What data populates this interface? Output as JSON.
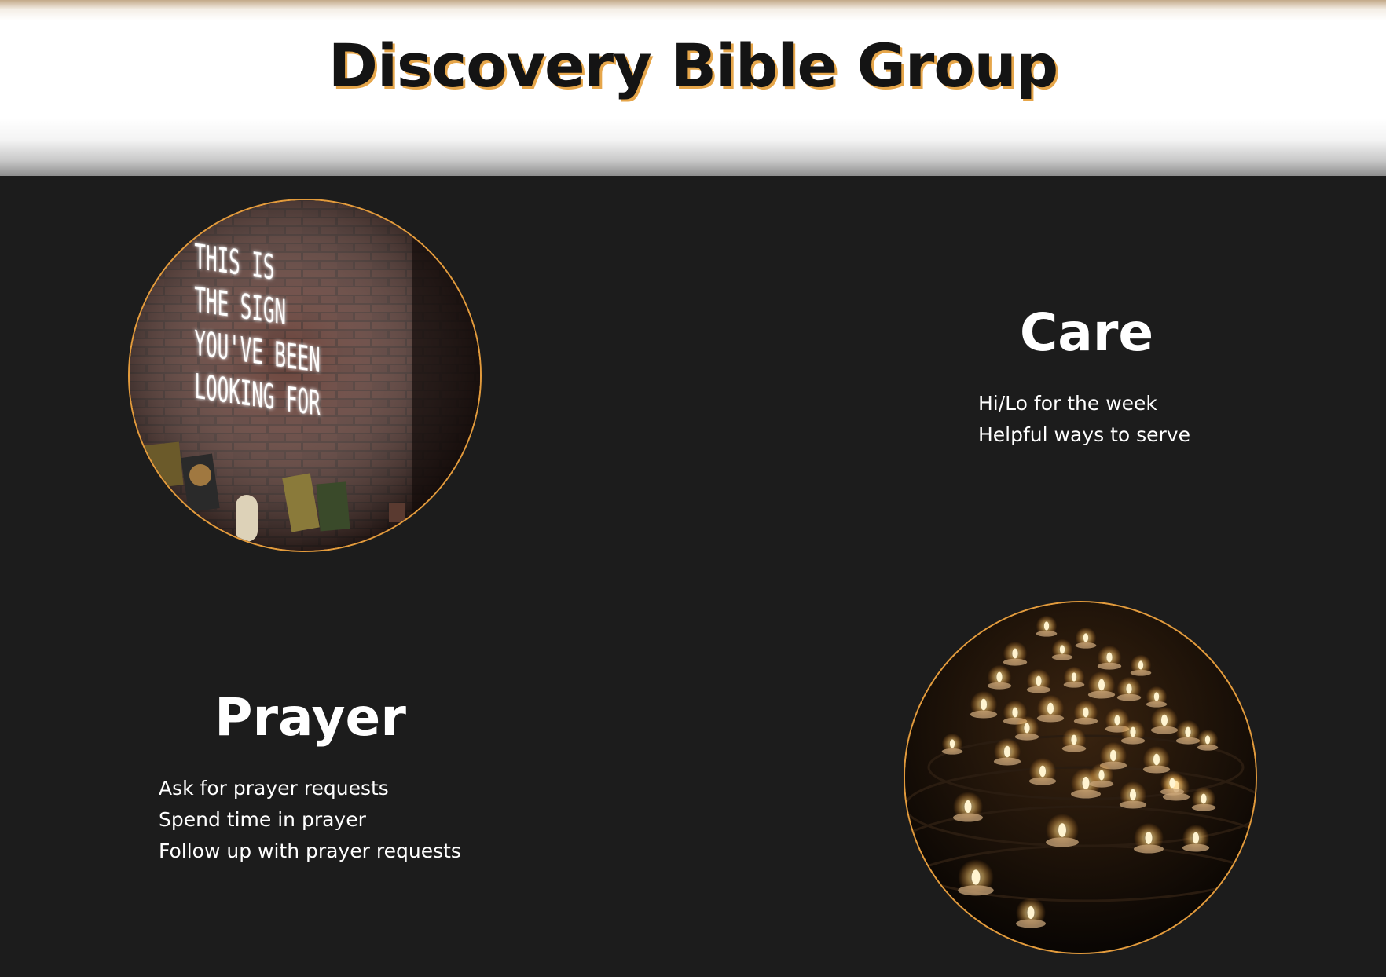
{
  "header": {
    "title": "Discovery Bible Group"
  },
  "images": {
    "neon_sign": {
      "lines": [
        "THIS IS",
        "THE SIGN",
        "YOU'VE BEEN",
        "LOOKING FOR"
      ]
    },
    "candles": {}
  },
  "care": {
    "heading": "Care",
    "items": [
      "Hi/Lo for the week",
      "Helpful ways to serve"
    ]
  },
  "prayer": {
    "heading": "Prayer",
    "items": [
      "Ask for prayer requests",
      "Spend time in prayer",
      "Follow up with prayer requests"
    ]
  },
  "colors": {
    "page_background": "#1c1c1c",
    "accent_orange": "#e39b3c",
    "title_shadow": "#e6a64a",
    "text_white": "#ffffff",
    "title_dark": "#141414"
  }
}
